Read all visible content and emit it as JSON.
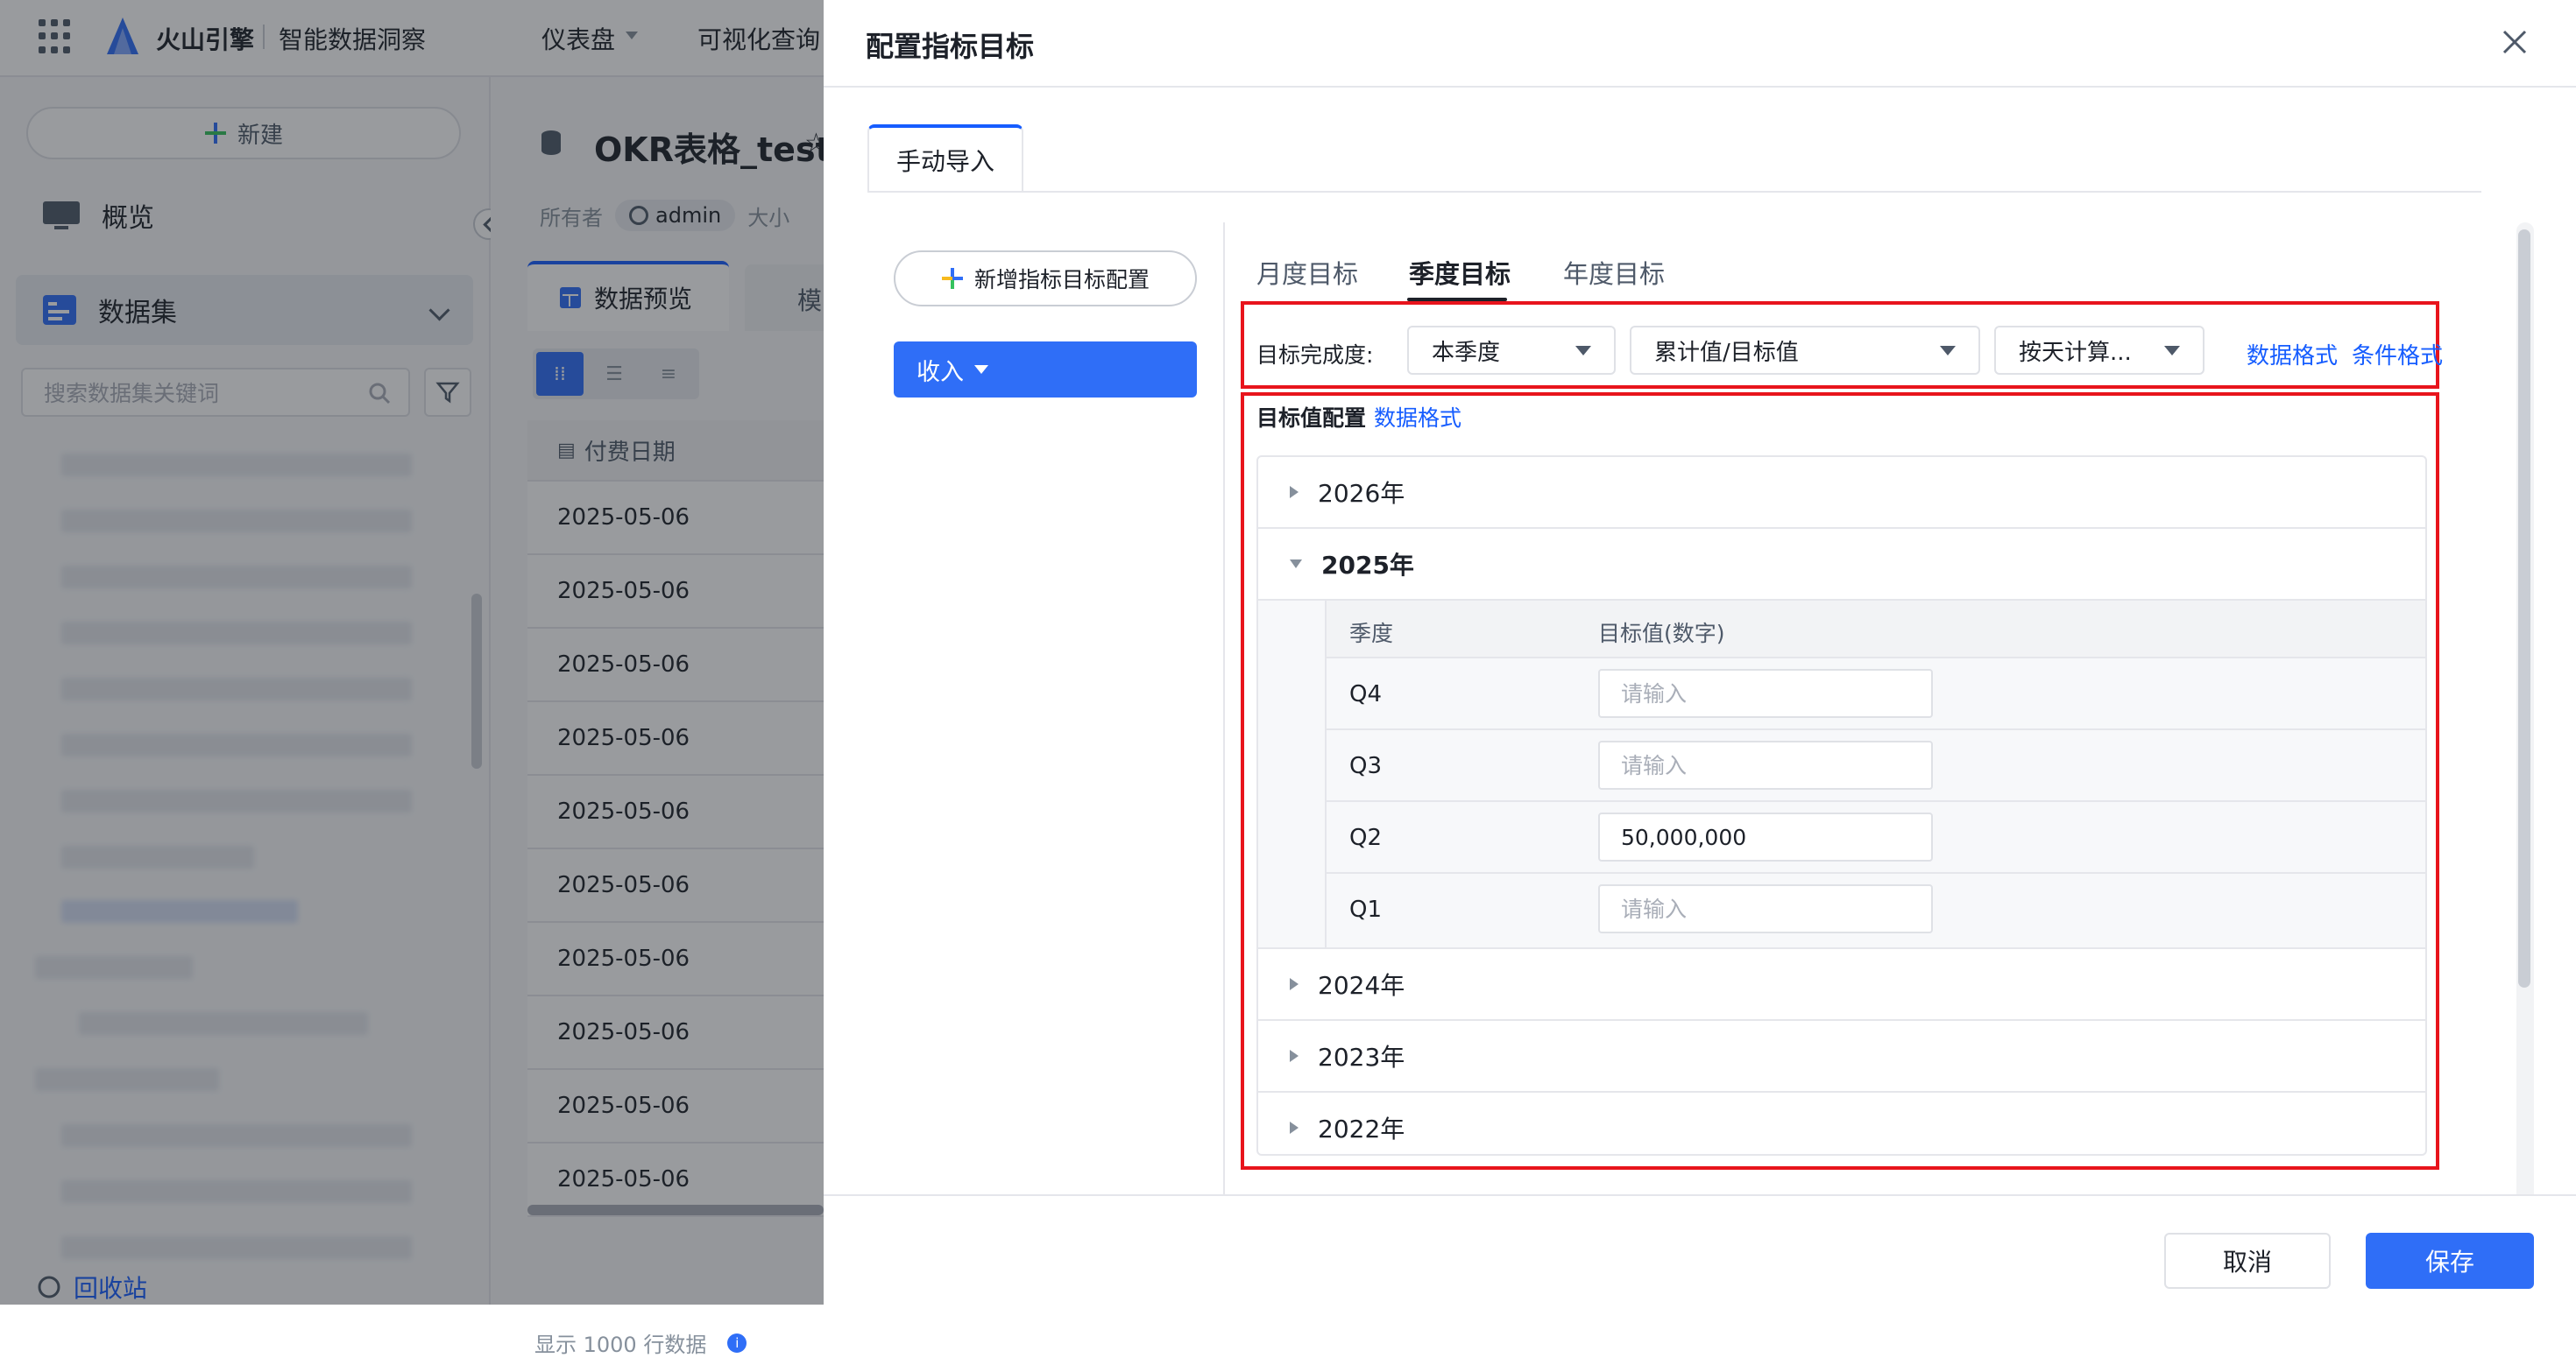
{
  "app": {
    "brand": "火山引擎",
    "product": "智能数据洞察",
    "nav": [
      "仪表盘",
      "可视化查询"
    ]
  },
  "sidebar": {
    "new_label": "新建",
    "overview_label": "概览",
    "dataset_label": "数据集",
    "search_placeholder": "搜索数据集关键词",
    "recycle_label": "回收站"
  },
  "dataset": {
    "title": "OKR表格_test",
    "owner_label": "所有者",
    "owner_name": "admin",
    "size_label": "大小",
    "tab_preview": "数据预览",
    "tab_other": "模",
    "column_header": "付费日期",
    "rows": [
      "2025-05-06",
      "2025-05-06",
      "2025-05-06",
      "2025-05-06",
      "2025-05-06",
      "2025-05-06",
      "2025-05-06",
      "2025-05-06",
      "2025-05-06",
      "2025-05-06"
    ],
    "row_count_text": "显示 1000 行数据"
  },
  "drawer": {
    "title": "配置指标目标",
    "import_tab": "手动导入",
    "add_config_label": "新增指标目标配置",
    "metric_label": "收入",
    "tabs": [
      {
        "label": "月度目标"
      },
      {
        "label": "季度目标"
      },
      {
        "label": "年度目标"
      }
    ],
    "completion": {
      "label": "目标完成度:",
      "period": "本季度",
      "mode": "累计值/目标值",
      "calc": "按天计算...",
      "link_format": "数据格式",
      "link_condition": "条件格式"
    },
    "config_label": "目标值配置",
    "config_format_link": "数据格式",
    "years": {
      "y2026": "2026年",
      "y2025": "2025年",
      "y2024": "2024年",
      "y2023": "2023年",
      "y2022": "2022年"
    },
    "quarter_table": {
      "col_quarter": "季度",
      "col_value": "目标值(数字)",
      "placeholder": "请输入",
      "rows": [
        {
          "quarter": "Q4",
          "value": ""
        },
        {
          "quarter": "Q3",
          "value": ""
        },
        {
          "quarter": "Q2",
          "value": "50,000,000"
        },
        {
          "quarter": "Q1",
          "value": ""
        }
      ]
    },
    "cancel_label": "取消",
    "save_label": "保存"
  },
  "colors": {
    "accent": "#2f6ef7",
    "link": "#165dff",
    "highlight_box": "#e8141c"
  }
}
